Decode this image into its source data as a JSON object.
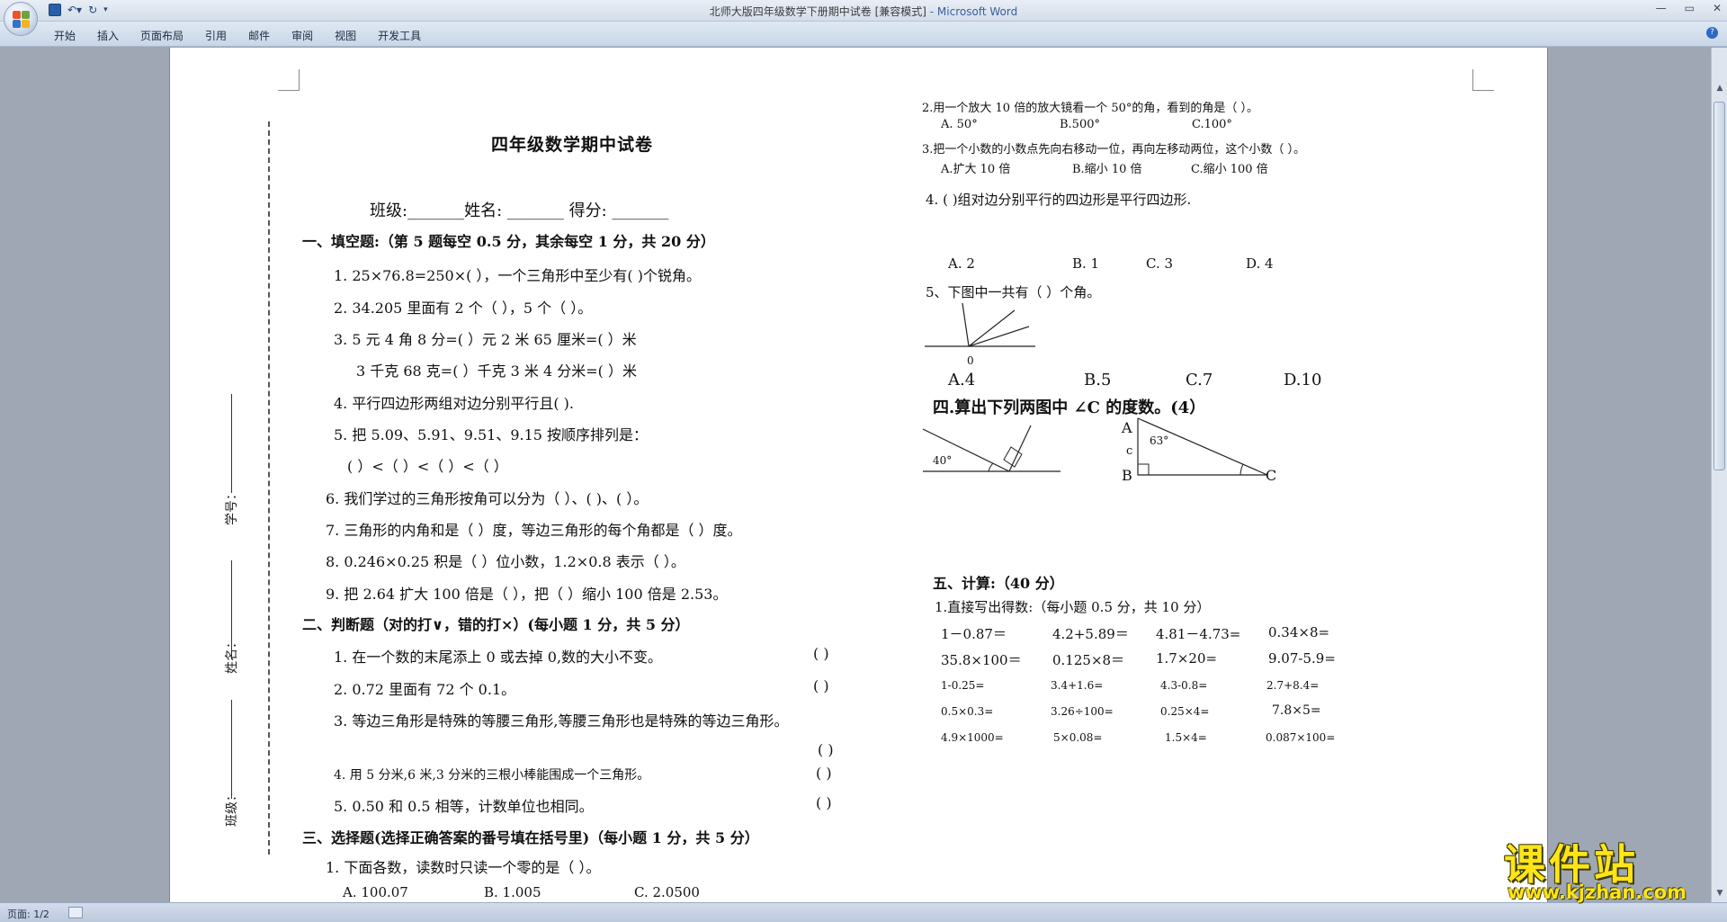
{
  "window": {
    "title": "北师大版四年级数学下册期中试卷 [兼容模式]",
    "app": " - Microsoft Word"
  },
  "ribbon": {
    "tabs": [
      "开始",
      "插入",
      "页面布局",
      "引用",
      "邮件",
      "审阅",
      "视图",
      "开发工具"
    ]
  },
  "status": {
    "page": "页面: 1/2"
  },
  "binding": {
    "student_no": "学号：",
    "name": "姓名：",
    "class": "班级："
  },
  "left": {
    "title": "四年级数学期中试卷",
    "info": "班级:_______姓名: _______    得分: _______",
    "sec1": "一、填空题:（第 5 题每空 0.5 分，其余每空 1 分，共 20 分）",
    "q1": "1.  25×76.8=250×(          ），一个三角形中至少有(     )个锐角。",
    "q2": "2.  34.205 里面有 2 个（              ），5 个（              ）。",
    "q3a": "3.  5 元 4 角 8 分=(        ）元      2 米 65 厘米=(          ）米",
    "q3b": "3 千克 68 克=(        ）千克     3 米 4 分米=(          ）米",
    "q4": "4.  平行四边形两组对边分别平行且(        ).",
    "q5": "5.  把 5.09、5.91、9.51、9.15 按顺序排列是：",
    "q5b": "(          ）<（          ）<（          ）<（          ）",
    "q6": "6.  我们学过的三角形按角可以分为（          ）、(          )、(          ）。",
    "q7": "7.  三角形的内角和是（          ）度，等边三角形的每个角都是（          ）度。",
    "q8": "8.   0.246×0.25 积是（        ）位小数，1.2×0.8 表示（                        ）。",
    "q9": "9.   把 2.64 扩大 100 倍是（            ），把（              ）缩小 100 倍是 2.53。",
    "sec2": "二、判断题（对的打∨，错的打×）(每小题 1 分，共 5 分）",
    "j1": "1. 在一个数的末尾添上 0 或去掉 0,数的大小不变。",
    "j2": "2.   0.72 里面有 72 个 0.1。",
    "j3": "3.  等边三角形是特殊的等腰三角形,等腰三角形也是特殊的等边三角形。",
    "j4": "4. 用 5 分米,6 米,3 分米的三根小棒能围成一个三角形。",
    "j5": "5.   0.50 和 0.5 相等，计数单位也相同。",
    "paren": "(      )",
    "sec3": "三、选择题(选择正确答案的番号填在括号里)（每小题 1 分，共 5 分）",
    "c1": "1. 下面各数，读数时只读一个零的是（       ）。",
    "c1a": "A. 100.07",
    "c1b": "B. 1.005",
    "c1c": "C. 2.0500"
  },
  "right": {
    "c2": "2.用一个放大 10 倍的放大镜看一个 50°的角，看到的角是（          ）。",
    "c2a": "A. 50°",
    "c2b": "B.500°",
    "c2c": "C.100°",
    "c3": "3.把一个小数的小数点先向右移动一位，再向左移动两位，这个小数（          ）。",
    "c3a": "A.扩大 10 倍",
    "c3b": "B.缩小 10 倍",
    "c3c": "C.缩小 100 倍",
    "c4": "4.  (       )组对边分别平行的四边形是平行四边形.",
    "c4a": "A.   2",
    "c4b": "B.    1",
    "c4c": "C.   3",
    "c4d": "D.   4",
    "c5": "5、下图中一共有（      ）个角。",
    "fig_zero": "0",
    "c5a": "A.4",
    "c5b": "B.5",
    "c5c": "C.7",
    "c5d": "D.10",
    "sec4": "四.算出下列两图中 ∠C 的度数。(4）",
    "fig_40": "40°",
    "fig_c_lower": "c",
    "fig_A": "A",
    "fig_63": "63°",
    "fig_B": "B",
    "fig_C": "C",
    "sec5": "五、计算:（40 分）",
    "calc_title": "1.直接写出得数:（每小题 0.5 分，共 10 分）",
    "calc_rows": [
      [
        "1－0.87＝",
        "4.2+5.89＝",
        "4.81－4.73=",
        "0.34×8="
      ],
      [
        "35.8×100＝",
        "0.125×8＝",
        "1.7×20=",
        "9.07-5.9="
      ],
      [
        "1-0.25=",
        "3.4+1.6=",
        "4.3-0.8=",
        "2.7+8.4="
      ],
      [
        "0.5×0.3=",
        "3.26÷100=",
        "0.25×4=",
        "7.8×5="
      ],
      [
        "4.9×1000=",
        "5×0.08=",
        "1.5×4=",
        "0.087×100="
      ]
    ]
  },
  "watermark": {
    "cn": "课件站",
    "url": "www.kjzhan.com"
  },
  "colors": {
    "ribbon": "#d4dde9",
    "workspace": "#9ea7b3",
    "watermark": "#ffe419"
  }
}
